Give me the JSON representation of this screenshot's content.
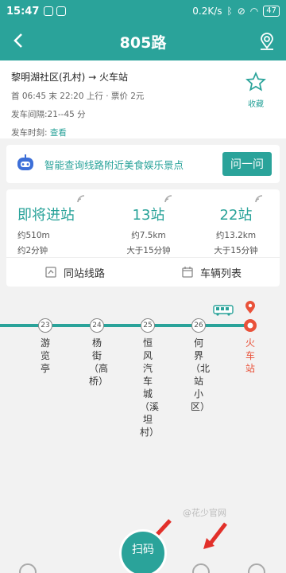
{
  "status_bar": {
    "time": "15:47",
    "net_speed": "0.2K/s",
    "battery": "47"
  },
  "header": {
    "title": "805路"
  },
  "route_info": {
    "from_to": "黎明湖社区(孔村) → 火车站",
    "first_last_price": "首 06:45 末 22:20 上行 · 票价 2元",
    "interval": "发车间隔:21--45 分",
    "schedule_label": "发车时刻:",
    "schedule_link": "查看",
    "favorite_label": "收藏"
  },
  "ai_card": {
    "text": "智能查询线路附近美食娱乐景点",
    "button": "问一问"
  },
  "arrivals": [
    {
      "title": "即将进站",
      "distance": "约510m",
      "time": "约2分钟"
    },
    {
      "title": "13站",
      "distance": "约7.5km",
      "time": "大于15分钟"
    },
    {
      "title": "22站",
      "distance": "约13.2km",
      "time": "大于15分钟"
    }
  ],
  "actions": {
    "same_stop": "同站线路",
    "vehicle_list": "车辆列表"
  },
  "stops": [
    {
      "num": "23",
      "name": "游览亭"
    },
    {
      "num": "24",
      "name": "杨街（高桥）"
    },
    {
      "num": "25",
      "name": "恒风汽车城（溪坦村）"
    },
    {
      "num": "26",
      "name": "何界（北站小区）"
    },
    {
      "num": "",
      "name": "火车站"
    }
  ],
  "bottom": {
    "scan_label": "扫码",
    "watermark": "@花少官网"
  },
  "colors": {
    "primary": "#2aa39a",
    "accent_red": "#e9523a"
  }
}
